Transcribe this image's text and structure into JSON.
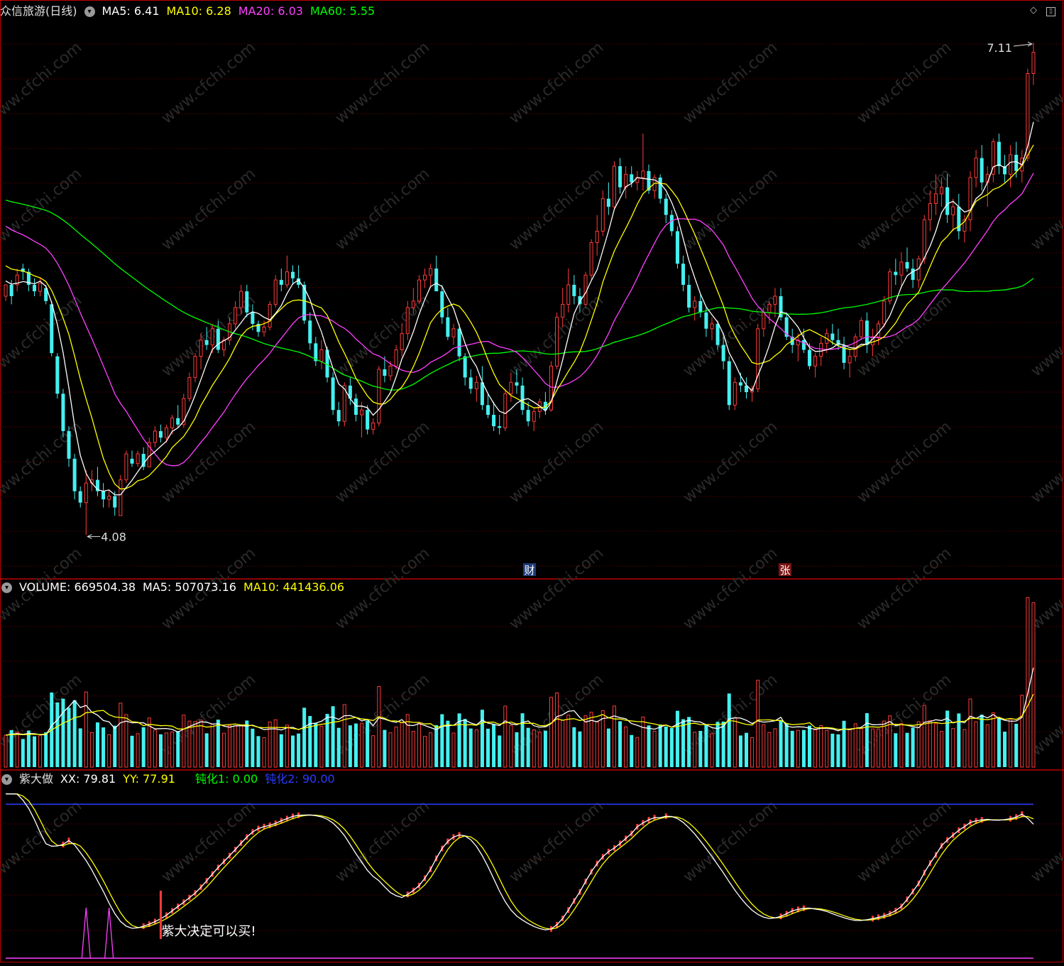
{
  "colors": {
    "up": "#ff3b3b",
    "down": "#45f0f0",
    "ma5": "#ffffff",
    "ma10": "#ffff00",
    "ma20": "#ff40ff",
    "ma60": "#00ff00",
    "grid": "#7a0000",
    "frame": "#c00000",
    "label_white": "#ffffff",
    "blue": "#2b3bff",
    "purple": "#ff40ff"
  },
  "header_main": {
    "stock": "众信旅游(日线)",
    "ma5_label": "MA5: 6.41",
    "ma10_label": "MA10: 6.28",
    "ma20_label": "MA20: 6.03",
    "ma60_label": "MA60: 5.55"
  },
  "header_volume": {
    "volume_label": "VOLUME: 669504.38",
    "ma5_label": "MA5: 507073.16",
    "ma10_label": "MA10: 441436.06"
  },
  "header_indicator": {
    "name": "紫大做",
    "xx_label": "XX: 79.81",
    "yy_label": "YY: 77.91",
    "dh1_label": "钝化1: 0.00",
    "dh2_label": "钝化2: 90.00"
  },
  "annotations": {
    "high_marker": "7.11",
    "low_marker": "4.08",
    "event_cai": "财",
    "event_zhang": "张",
    "buy_signal": "紫大决定可以买!"
  },
  "watermark": "www.cfchi.com",
  "icons": [
    "dropdown-circle-icon",
    "diamond-icon",
    "maximize-icon",
    "left-arrow-icon",
    "right-arrow-icon"
  ],
  "chart_data": [
    {
      "type": "candlestick",
      "series_names": [
        "MA5",
        "MA10",
        "MA20",
        "MA60"
      ],
      "ylim": [
        3.85,
        7.25
      ],
      "high": 7.11,
      "low": 4.08,
      "bars": [
        [
          5.55,
          5.62,
          5.52,
          5.62
        ],
        [
          5.62,
          5.65,
          5.5,
          5.55
        ],
        [
          5.62,
          5.72,
          5.58,
          5.68
        ],
        [
          5.72,
          5.75,
          5.65,
          5.7
        ],
        [
          5.7,
          5.72,
          5.58,
          5.62
        ],
        [
          5.62,
          5.66,
          5.55,
          5.58
        ],
        [
          5.58,
          5.66,
          5.55,
          5.63
        ],
        [
          5.6,
          5.62,
          5.5,
          5.52
        ],
        [
          5.5,
          5.52,
          5.18,
          5.2
        ],
        [
          5.18,
          5.2,
          4.92,
          4.95
        ],
        [
          4.95,
          4.98,
          4.68,
          4.72
        ],
        [
          4.72,
          4.75,
          4.5,
          4.55
        ],
        [
          4.55,
          4.58,
          4.3,
          4.35
        ],
        [
          4.35,
          4.38,
          4.25,
          4.28
        ],
        [
          4.28,
          4.48,
          4.08,
          4.4
        ],
        [
          4.4,
          4.48,
          4.35,
          4.42
        ],
        [
          4.42,
          4.5,
          4.32,
          4.35
        ],
        [
          4.35,
          4.4,
          4.25,
          4.3
        ],
        [
          4.3,
          4.36,
          4.25,
          4.32
        ],
        [
          4.32,
          4.35,
          4.2,
          4.25
        ],
        [
          4.2,
          4.45,
          4.2,
          4.42
        ],
        [
          4.42,
          4.6,
          4.4,
          4.58
        ],
        [
          4.55,
          4.6,
          4.5,
          4.52
        ],
        [
          4.52,
          4.6,
          4.5,
          4.58
        ],
        [
          4.58,
          4.62,
          4.48,
          4.5
        ],
        [
          4.5,
          4.68,
          4.5,
          4.65
        ],
        [
          4.65,
          4.75,
          4.62,
          4.72
        ],
        [
          4.72,
          4.76,
          4.65,
          4.68
        ],
        [
          4.68,
          4.76,
          4.65,
          4.74
        ],
        [
          4.74,
          4.82,
          4.7,
          4.8
        ],
        [
          4.8,
          4.88,
          4.74,
          4.76
        ],
        [
          4.76,
          4.95,
          4.74,
          4.92
        ],
        [
          4.92,
          5.08,
          4.9,
          5.05
        ],
        [
          5.05,
          5.2,
          5.02,
          5.18
        ],
        [
          5.18,
          5.32,
          5.1,
          5.28
        ],
        [
          5.28,
          5.36,
          5.22,
          5.25
        ],
        [
          5.25,
          5.38,
          5.2,
          5.35
        ],
        [
          5.35,
          5.4,
          5.2,
          5.22
        ],
        [
          5.22,
          5.3,
          5.18,
          5.28
        ],
        [
          5.28,
          5.42,
          5.25,
          5.38
        ],
        [
          5.38,
          5.52,
          5.35,
          5.48
        ],
        [
          5.48,
          5.62,
          5.44,
          5.58
        ],
        [
          5.58,
          5.62,
          5.42,
          5.45
        ],
        [
          5.45,
          5.5,
          5.34,
          5.38
        ],
        [
          5.38,
          5.4,
          5.3,
          5.33
        ],
        [
          5.33,
          5.4,
          5.3,
          5.36
        ],
        [
          5.36,
          5.52,
          5.34,
          5.5
        ],
        [
          5.5,
          5.68,
          5.48,
          5.65
        ],
        [
          5.65,
          5.72,
          5.58,
          5.62
        ],
        [
          5.62,
          5.8,
          5.6,
          5.7
        ],
        [
          5.7,
          5.74,
          5.62,
          5.66
        ],
        [
          5.66,
          5.74,
          5.6,
          5.62
        ],
        [
          5.62,
          5.64,
          5.38,
          5.4
        ],
        [
          5.4,
          5.45,
          5.22,
          5.26
        ],
        [
          5.26,
          5.3,
          5.12,
          5.15
        ],
        [
          5.15,
          5.28,
          5.1,
          5.22
        ],
        [
          5.22,
          5.24,
          5.02,
          5.05
        ],
        [
          5.05,
          5.08,
          4.82,
          4.85
        ],
        [
          4.85,
          4.9,
          4.75,
          4.78
        ],
        [
          4.78,
          5.02,
          4.75,
          5.0
        ],
        [
          5.0,
          5.05,
          4.88,
          4.92
        ],
        [
          4.92,
          4.95,
          4.78,
          4.82
        ],
        [
          4.82,
          4.9,
          4.68,
          4.85
        ],
        [
          4.85,
          4.88,
          4.7,
          4.73
        ],
        [
          4.73,
          4.8,
          4.7,
          4.77
        ],
        [
          4.77,
          5.12,
          4.75,
          5.1
        ],
        [
          5.1,
          5.18,
          5.02,
          5.06
        ],
        [
          5.06,
          5.15,
          5.03,
          5.12
        ],
        [
          5.12,
          5.25,
          5.1,
          5.22
        ],
        [
          5.22,
          5.38,
          5.18,
          5.32
        ],
        [
          5.32,
          5.52,
          5.28,
          5.48
        ],
        [
          5.48,
          5.6,
          5.44,
          5.52
        ],
        [
          5.52,
          5.68,
          5.5,
          5.65
        ],
        [
          5.65,
          5.72,
          5.6,
          5.68
        ],
        [
          5.68,
          5.75,
          5.6,
          5.72
        ],
        [
          5.72,
          5.8,
          5.65,
          5.58
        ],
        [
          5.58,
          5.62,
          5.38,
          5.42
        ],
        [
          5.42,
          5.48,
          5.28,
          5.3
        ],
        [
          5.3,
          5.38,
          5.25,
          5.35
        ],
        [
          5.35,
          5.38,
          5.15,
          5.18
        ],
        [
          5.18,
          5.2,
          5.0,
          5.05
        ],
        [
          5.05,
          5.1,
          4.95,
          4.98
        ],
        [
          4.98,
          5.06,
          4.9,
          5.02
        ],
        [
          5.02,
          5.12,
          4.85,
          4.88
        ],
        [
          4.88,
          4.95,
          4.8,
          4.82
        ],
        [
          4.82,
          4.9,
          4.72,
          4.75
        ],
        [
          4.75,
          4.82,
          4.7,
          4.74
        ],
        [
          4.74,
          4.98,
          4.72,
          4.95
        ],
        [
          4.95,
          5.08,
          4.9,
          5.02
        ],
        [
          5.02,
          5.1,
          4.95,
          5.0
        ],
        [
          5.0,
          5.05,
          4.82,
          4.85
        ],
        [
          4.85,
          4.9,
          4.75,
          4.78
        ],
        [
          4.78,
          4.86,
          4.72,
          4.84
        ],
        [
          4.84,
          4.92,
          4.8,
          4.9
        ],
        [
          4.9,
          4.96,
          4.82,
          4.85
        ],
        [
          4.85,
          5.15,
          4.84,
          5.12
        ],
        [
          5.12,
          5.45,
          5.1,
          5.42
        ],
        [
          5.42,
          5.6,
          5.36,
          5.5
        ],
        [
          5.5,
          5.72,
          5.45,
          5.62
        ],
        [
          5.62,
          5.68,
          5.5,
          5.55
        ],
        [
          5.55,
          5.6,
          5.45,
          5.5
        ],
        [
          5.5,
          5.7,
          5.48,
          5.68
        ],
        [
          5.68,
          5.9,
          5.65,
          5.88
        ],
        [
          5.88,
          6.05,
          5.8,
          5.95
        ],
        [
          5.95,
          6.2,
          5.92,
          6.15
        ],
        [
          6.15,
          6.25,
          6.05,
          6.1
        ],
        [
          6.1,
          6.38,
          6.08,
          6.35
        ],
        [
          6.35,
          6.4,
          6.18,
          6.22
        ],
        [
          6.22,
          6.35,
          6.15,
          6.3
        ],
        [
          6.3,
          6.35,
          6.22,
          6.25
        ],
        [
          6.25,
          6.32,
          6.2,
          6.28
        ],
        [
          6.28,
          6.55,
          6.2,
          6.32
        ],
        [
          6.32,
          6.36,
          6.18,
          6.2
        ],
        [
          6.2,
          6.3,
          6.15,
          6.28
        ],
        [
          6.28,
          6.3,
          6.12,
          6.15
        ],
        [
          6.15,
          6.18,
          6.0,
          6.05
        ],
        [
          6.05,
          6.08,
          5.92,
          5.95
        ],
        [
          5.95,
          5.98,
          5.72,
          5.75
        ],
        [
          5.75,
          5.8,
          5.58,
          5.62
        ],
        [
          5.62,
          5.68,
          5.45,
          5.48
        ],
        [
          5.48,
          5.55,
          5.4,
          5.52
        ],
        [
          5.52,
          5.56,
          5.42,
          5.45
        ],
        [
          5.45,
          5.48,
          5.3,
          5.35
        ],
        [
          5.35,
          5.42,
          5.28,
          5.38
        ],
        [
          5.38,
          5.4,
          5.22,
          5.25
        ],
        [
          5.25,
          5.3,
          5.1,
          5.15
        ],
        [
          5.15,
          5.18,
          4.85,
          4.88
        ],
        [
          4.88,
          5.05,
          4.85,
          5.02
        ],
        [
          5.02,
          5.08,
          4.96,
          5.0
        ],
        [
          5.0,
          5.05,
          4.92,
          4.96
        ],
        [
          4.96,
          5.0,
          4.9,
          4.98
        ],
        [
          4.98,
          5.38,
          4.96,
          5.35
        ],
        [
          5.35,
          5.48,
          5.3,
          5.45
        ],
        [
          5.45,
          5.52,
          5.38,
          5.5
        ],
        [
          5.5,
          5.6,
          5.42,
          5.55
        ],
        [
          5.55,
          5.6,
          5.4,
          5.42
        ],
        [
          5.42,
          5.45,
          5.28,
          5.3
        ],
        [
          5.3,
          5.35,
          5.2,
          5.25
        ],
        [
          5.25,
          5.32,
          5.15,
          5.28
        ],
        [
          5.28,
          5.35,
          5.2,
          5.22
        ],
        [
          5.22,
          5.26,
          5.1,
          5.12
        ],
        [
          5.12,
          5.2,
          5.05,
          5.18
        ],
        [
          5.18,
          5.3,
          5.12,
          5.26
        ],
        [
          5.26,
          5.35,
          5.2,
          5.32
        ],
        [
          5.32,
          5.38,
          5.25,
          5.28
        ],
        [
          5.28,
          5.35,
          5.22,
          5.25
        ],
        [
          5.25,
          5.3,
          5.1,
          5.14
        ],
        [
          5.14,
          5.22,
          5.05,
          5.18
        ],
        [
          5.18,
          5.32,
          5.15,
          5.3
        ],
        [
          5.3,
          5.42,
          5.28,
          5.4
        ],
        [
          5.4,
          5.45,
          5.2,
          5.25
        ],
        [
          5.25,
          5.35,
          5.18,
          5.3
        ],
        [
          5.3,
          5.4,
          5.25,
          5.38
        ],
        [
          5.38,
          5.55,
          5.36,
          5.52
        ],
        [
          5.52,
          5.72,
          5.5,
          5.7
        ],
        [
          5.7,
          5.78,
          5.62,
          5.68
        ],
        [
          5.68,
          5.82,
          5.6,
          5.76
        ],
        [
          5.76,
          5.85,
          5.7,
          5.72
        ],
        [
          5.72,
          5.78,
          5.6,
          5.65
        ],
        [
          5.65,
          5.8,
          5.6,
          5.78
        ],
        [
          5.78,
          6.05,
          5.75,
          6.02
        ],
        [
          6.02,
          6.2,
          5.95,
          6.12
        ],
        [
          6.12,
          6.3,
          6.05,
          6.18
        ],
        [
          6.18,
          6.28,
          6.1,
          6.22
        ],
        [
          6.22,
          6.3,
          6.0,
          6.05
        ],
        [
          6.05,
          6.15,
          5.95,
          6.1
        ],
        [
          6.1,
          6.18,
          5.9,
          5.95
        ],
        [
          5.95,
          6.05,
          5.88,
          6.02
        ],
        [
          6.02,
          6.32,
          5.95,
          6.28
        ],
        [
          6.28,
          6.45,
          6.22,
          6.4
        ],
        [
          6.4,
          6.48,
          6.2,
          6.25
        ],
        [
          6.25,
          6.35,
          6.1,
          6.3
        ],
        [
          6.3,
          6.52,
          6.25,
          6.5
        ],
        [
          6.5,
          6.55,
          6.3,
          6.35
        ],
        [
          6.35,
          6.42,
          6.25,
          6.3
        ],
        [
          6.3,
          6.48,
          6.22,
          6.42
        ],
        [
          6.42,
          6.5,
          6.28,
          6.32
        ],
        [
          6.32,
          6.45,
          6.25,
          6.4
        ],
        [
          6.4,
          6.95,
          6.38,
          6.92
        ],
        [
          6.92,
          7.11,
          6.85,
          7.05
        ]
      ]
    },
    {
      "type": "bar",
      "name": "VOLUME",
      "series_names": [
        "MA5",
        "MA10"
      ],
      "ylim": [
        0,
        700000
      ],
      "latest": 669504.38,
      "ma5_latest": 507073.16,
      "ma10_latest": 441436.06
    },
    {
      "type": "line",
      "name": "紫大做",
      "series_names": [
        "XX",
        "YY",
        "钝化1",
        "钝化2"
      ],
      "ylim": [
        0,
        100
      ],
      "latest": {
        "XX": 79.81,
        "YY": 77.91,
        "钝化1": 0.0,
        "钝化2": 90.0
      }
    }
  ]
}
